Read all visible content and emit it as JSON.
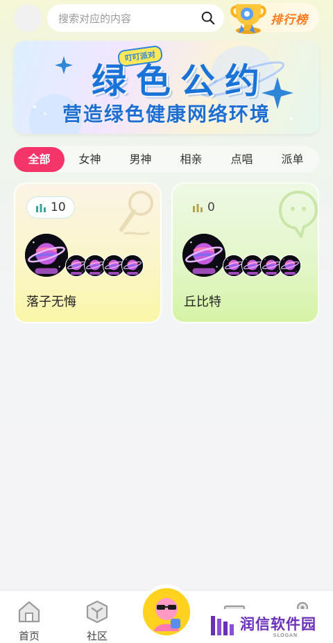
{
  "header": {
    "search_placeholder": "搜索对应的内容",
    "ranking_label": "排行榜"
  },
  "banner": {
    "tag": "叮叮派对",
    "title": "绿色公约",
    "subtitle": "营造绿色健康网络环境"
  },
  "categories": {
    "active_index": 0,
    "items": [
      "全部",
      "女神",
      "男神",
      "相亲",
      "点唱",
      "派单"
    ]
  },
  "rooms": [
    {
      "name": "落子无悔",
      "count": "10",
      "theme": "yellow",
      "watermark": "microphone-icon"
    },
    {
      "name": "丘比特",
      "count": "0",
      "theme": "green",
      "watermark": "chat-bubble-icon"
    }
  ],
  "bottom_nav": {
    "items": [
      {
        "label": "首页",
        "icon": "home-icon"
      },
      {
        "label": "社区",
        "icon": "cube-icon"
      },
      {
        "label": "",
        "icon": "party-mascot-icon"
      },
      {
        "label": "",
        "icon": "message-icon"
      },
      {
        "label": "",
        "icon": "profile-icon"
      }
    ]
  },
  "watermark": {
    "name": "润信软件园",
    "slogan": "SLOGAN"
  },
  "colors": {
    "accent": "#f3356a",
    "banner_text": "#1a74d8",
    "ranking_text": "#ff7a1c"
  }
}
